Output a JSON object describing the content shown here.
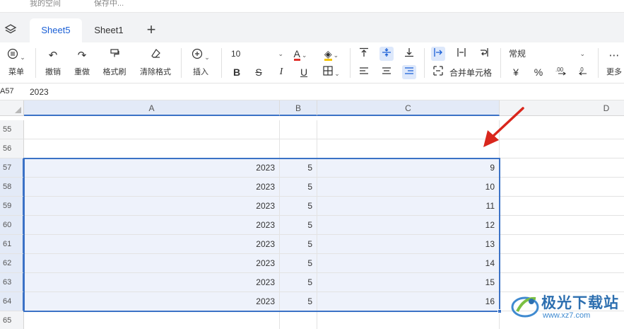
{
  "topstrip": {
    "left_fragment": "我的空间",
    "right_fragment": "保存中..."
  },
  "tabs": [
    {
      "label": "Sheet5",
      "active": true
    },
    {
      "label": "Sheet1",
      "active": false
    }
  ],
  "add_tab_symbol": "+",
  "toolbar": {
    "menu": "菜单",
    "undo": "撤销",
    "redo": "重做",
    "format_painter": "格式刷",
    "clear_format": "清除格式",
    "insert": "插入",
    "font_size": "10",
    "bold": "B",
    "strikethrough": "S",
    "italic": "I",
    "underline": "U",
    "merge_cells": "合并单元格",
    "number_format": "常规",
    "currency": "¥",
    "percent": "%",
    "more": "更多",
    "more_dots": "⋯"
  },
  "formula_bar": {
    "cell_ref": "A57",
    "value": "2023"
  },
  "columns": [
    "A",
    "B",
    "C",
    "D"
  ],
  "rows": [
    {
      "num": "55",
      "a": "",
      "b": "",
      "c": ""
    },
    {
      "num": "56",
      "a": "",
      "b": "",
      "c": ""
    },
    {
      "num": "57",
      "a": "2023",
      "b": "5",
      "c": "9"
    },
    {
      "num": "58",
      "a": "2023",
      "b": "5",
      "c": "10"
    },
    {
      "num": "59",
      "a": "2023",
      "b": "5",
      "c": "11"
    },
    {
      "num": "60",
      "a": "2023",
      "b": "5",
      "c": "12"
    },
    {
      "num": "61",
      "a": "2023",
      "b": "5",
      "c": "13"
    },
    {
      "num": "62",
      "a": "2023",
      "b": "5",
      "c": "14"
    },
    {
      "num": "63",
      "a": "2023",
      "b": "5",
      "c": "15"
    },
    {
      "num": "64",
      "a": "2023",
      "b": "5",
      "c": "16"
    },
    {
      "num": "65",
      "a": "",
      "b": "",
      "c": ""
    }
  ],
  "watermark": {
    "title": "极光下载站",
    "url": "www.xz7.com"
  },
  "colors": {
    "accent": "#1a5fd6",
    "selection_border": "#3b72c6",
    "selection_fill": "#eef2fb",
    "annotation_arrow": "#d9261c"
  }
}
